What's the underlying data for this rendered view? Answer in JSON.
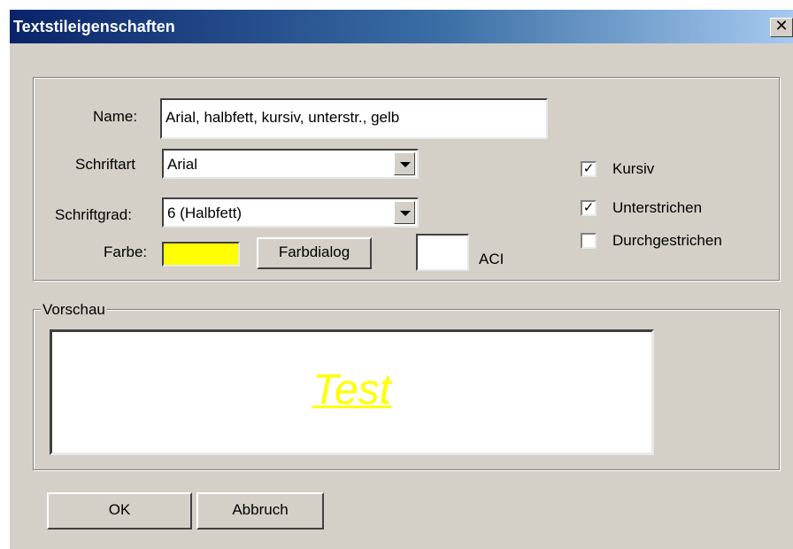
{
  "window": {
    "title": "Textstileigenschaften",
    "close_glyph": "×"
  },
  "form": {
    "name_label": "Name:",
    "name_value": "Arial, halbfett, kursiv, unterstr., gelb",
    "font_label": "Schriftart",
    "font_value": "Arial",
    "size_label": "Schriftgrad:",
    "size_value": "6 (Halbfett)",
    "color_label": "Farbe:",
    "color_value": "#ffff00",
    "color_dialog_button": "Farbdialog",
    "aci_value": "",
    "aci_label": "ACI"
  },
  "options": {
    "italic": {
      "label": "Kursiv",
      "checked": true
    },
    "underline": {
      "label": "Unterstrichen",
      "checked": true
    },
    "strikethrough": {
      "label": "Durchgestrichen",
      "checked": false
    }
  },
  "preview": {
    "legend": "Vorschau",
    "text": "Test",
    "color": "#ffff00"
  },
  "buttons": {
    "ok": "OK",
    "cancel": "Abbruch"
  }
}
